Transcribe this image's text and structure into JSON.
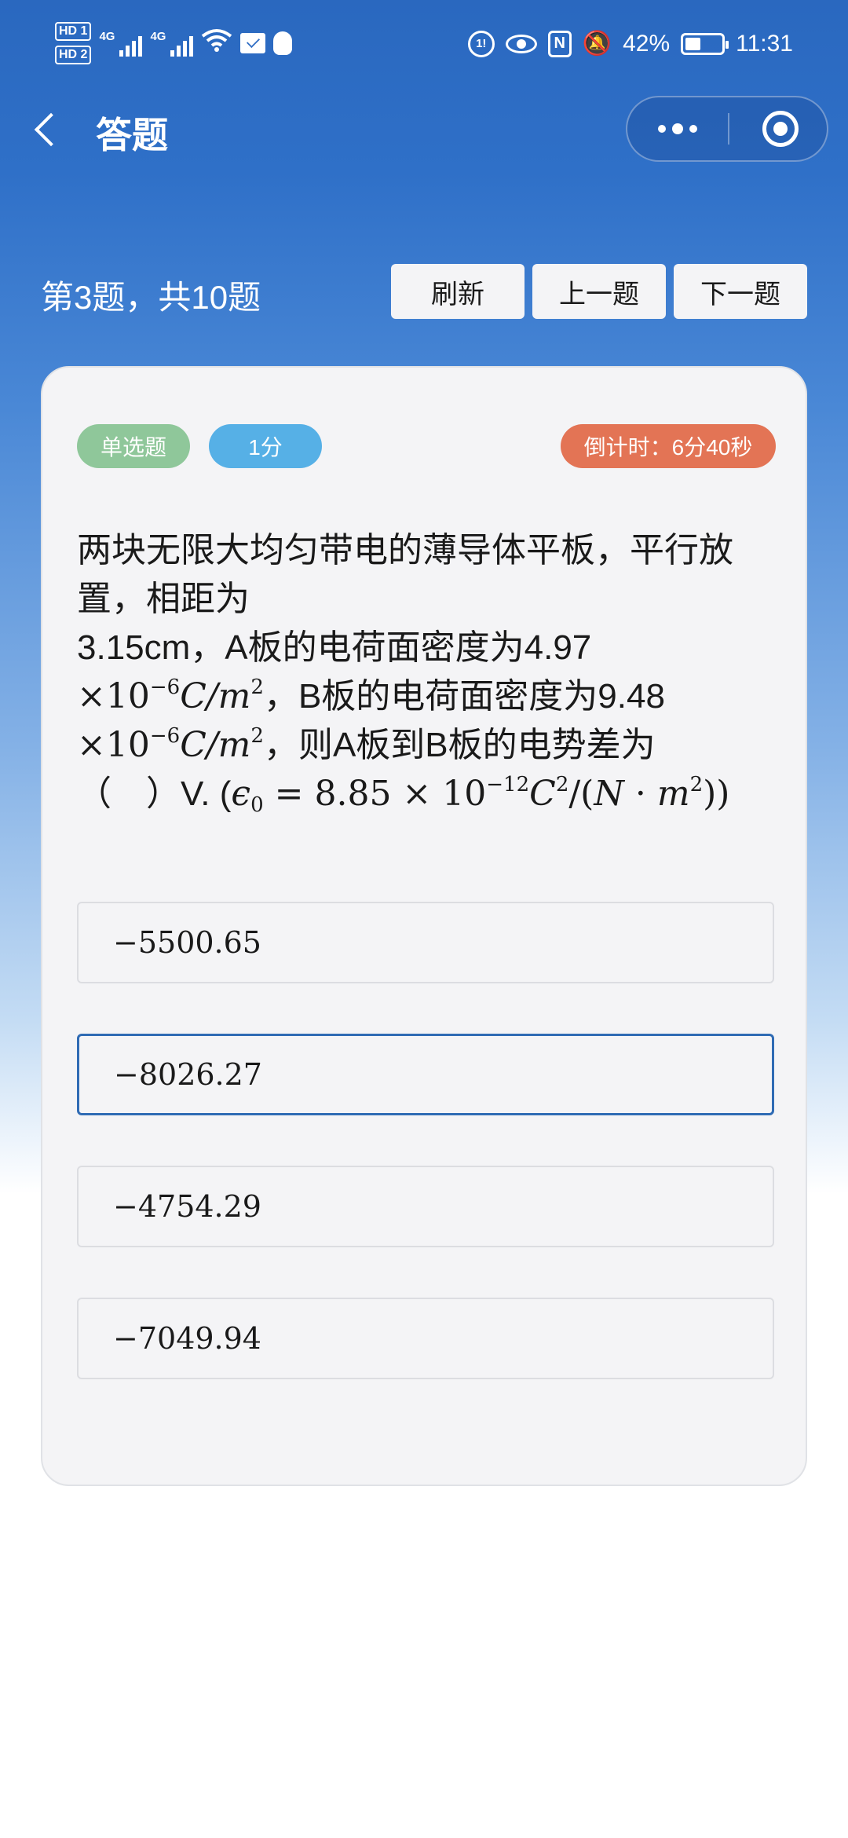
{
  "status_bar": {
    "hd1": "HD 1",
    "hd2": "HD 2",
    "net1": "4G",
    "net2": "4G",
    "battery_percent": "42%",
    "time": "11:31",
    "icons": [
      "signal-icon",
      "wifi-icon",
      "mail-icon",
      "qq-icon",
      "data-saver-icon",
      "eye-comfort-icon",
      "nfc-icon",
      "mute-icon",
      "battery-icon"
    ]
  },
  "nav": {
    "title": "答题"
  },
  "toolbar": {
    "progress": "第3题，共10题",
    "refresh": "刷新",
    "prev": "上一题",
    "next": "下一题"
  },
  "card": {
    "type_badge": "单选题",
    "score_badge": "1分",
    "timer": "倒计时：6分40秒",
    "question": {
      "line1": "两块无限大均匀带电的薄导体平板，平行放置，相距为",
      "line2": "3.15cm，A板的电荷面密度为4.97",
      "times": "×10",
      "exp": "−6",
      "unit_c": "C",
      "unit_m": "/m",
      "sq": "2",
      "mid": "，B板的电荷面密度为9.48",
      "tail": "，则A板到B板的电势差为",
      "blank": "（　）V. (",
      "eps": "ϵ",
      "eps_sub": "0",
      "eps_eq": " = 8.85 × 10",
      "exp12": "−12",
      "tail2_a": "C",
      "tail2_b": "/(",
      "tail2_n": "N",
      "tail2_dot": " · ",
      "tail2_m": "m",
      "tail2_close": "))"
    },
    "options": [
      "−5500.65",
      "−8026.27",
      "−4754.29",
      "−7049.94"
    ],
    "selected_index": 1
  },
  "colors": {
    "header_blue": "#2a68bf",
    "type_badge": "#8fc79a",
    "score_badge": "#56b0e6",
    "timer_badge": "#e37455",
    "selected_border": "#2f6bb4"
  }
}
